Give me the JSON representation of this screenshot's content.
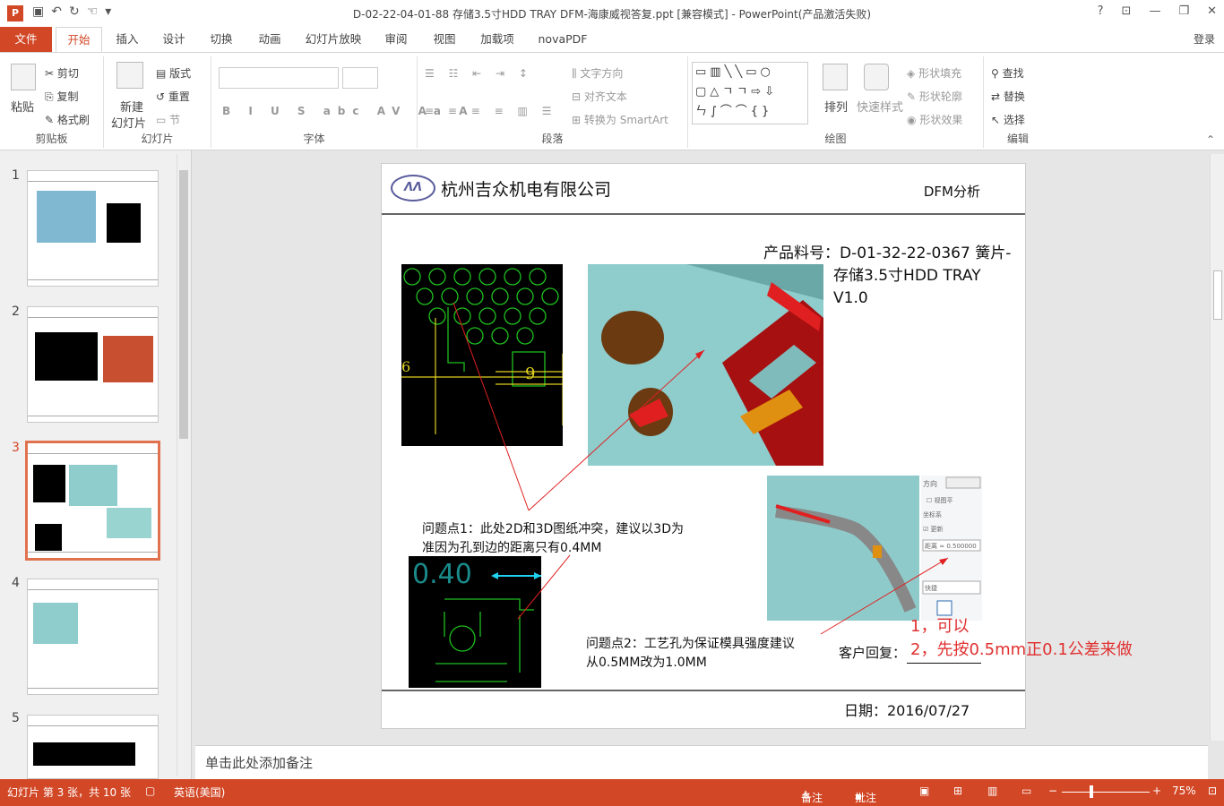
{
  "titlebar": {
    "app_icon": "P",
    "title": "D-02-22-04-01-88 存储3.5寸HDD TRAY DFM-海康威视答复.ppt [兼容模式] - PowerPoint(产品激活失败)",
    "help": "?",
    "restore": "⊡",
    "minimize": "—",
    "maximize": "❐",
    "close": "✕"
  },
  "qat": {
    "save_icon": "save-icon",
    "undo_icon": "undo-icon",
    "redo_icon": "redo-icon"
  },
  "tabs": [
    "文件",
    "开始",
    "插入",
    "设计",
    "切换",
    "动画",
    "幻灯片放映",
    "审阅",
    "视图",
    "加载项",
    "novaPDF"
  ],
  "login_label": "登录",
  "ribbon": {
    "clipboard": {
      "label": "剪贴板",
      "paste": "粘贴",
      "cut": "剪切",
      "copy": "复制",
      "format_painter": "格式刷"
    },
    "slides": {
      "label": "幻灯片",
      "new_slide_1": "新建",
      "new_slide_2": "幻灯片",
      "layout": "版式",
      "reset": "重置",
      "section": "节"
    },
    "font": {
      "label": "字体"
    },
    "paragraph": {
      "label": "段落",
      "text_direction": "文字方向",
      "align_text": "对齐文本",
      "convert_smartart": "转换为 SmartArt"
    },
    "drawing": {
      "label": "绘图",
      "arrange": "排列",
      "quick_styles": "快速样式",
      "shape_fill": "形状填充",
      "shape_outline": "形状轮廓",
      "shape_effects": "形状效果"
    },
    "editing": {
      "label": "编辑",
      "find": "查找",
      "replace": "替换",
      "select": "选择"
    }
  },
  "thumbnails": [
    {
      "num": "1",
      "selected": false
    },
    {
      "num": "2",
      "selected": false
    },
    {
      "num": "3",
      "selected": true
    },
    {
      "num": "4",
      "selected": false
    },
    {
      "num": "5",
      "selected": false
    }
  ],
  "slide": {
    "logo": "ΛΛ",
    "company": "杭州吉众机电有限公司",
    "dfm": "DFM分析",
    "product_line1": "产品料号：D-01-32-22-0367 簧片-",
    "product_line2": "存储3.5寸HDD TRAY",
    "product_line3": "V1.0",
    "issue1_line1": "问题点1：此处2D和3D图纸冲突，建议以3D为",
    "issue1_line2": "准因为孔到边的距离只有0.4MM",
    "issue2_line1": "问题点2：工艺孔为保证模具强度建议",
    "issue2_line2": "从0.5MM改为1.0MM",
    "reply_label": "客户回复：",
    "reply1": "1，可以",
    "reply2": "2，先按0.5mm正0.1公差来做",
    "date": "日期：2016/07/27",
    "cad1_dim1": "6",
    "cad1_dim2": "9",
    "cad2_dim": "0.40"
  },
  "notes_placeholder": "单击此处添加备注",
  "status": {
    "slide_count": "幻灯片 第 3 张，共 10 张",
    "language": "英语(美国)",
    "notes": "备注",
    "comments": "批注",
    "zoom": "75%"
  },
  "colors": {
    "accent": "#d24726",
    "reply_red": "#e03030"
  }
}
